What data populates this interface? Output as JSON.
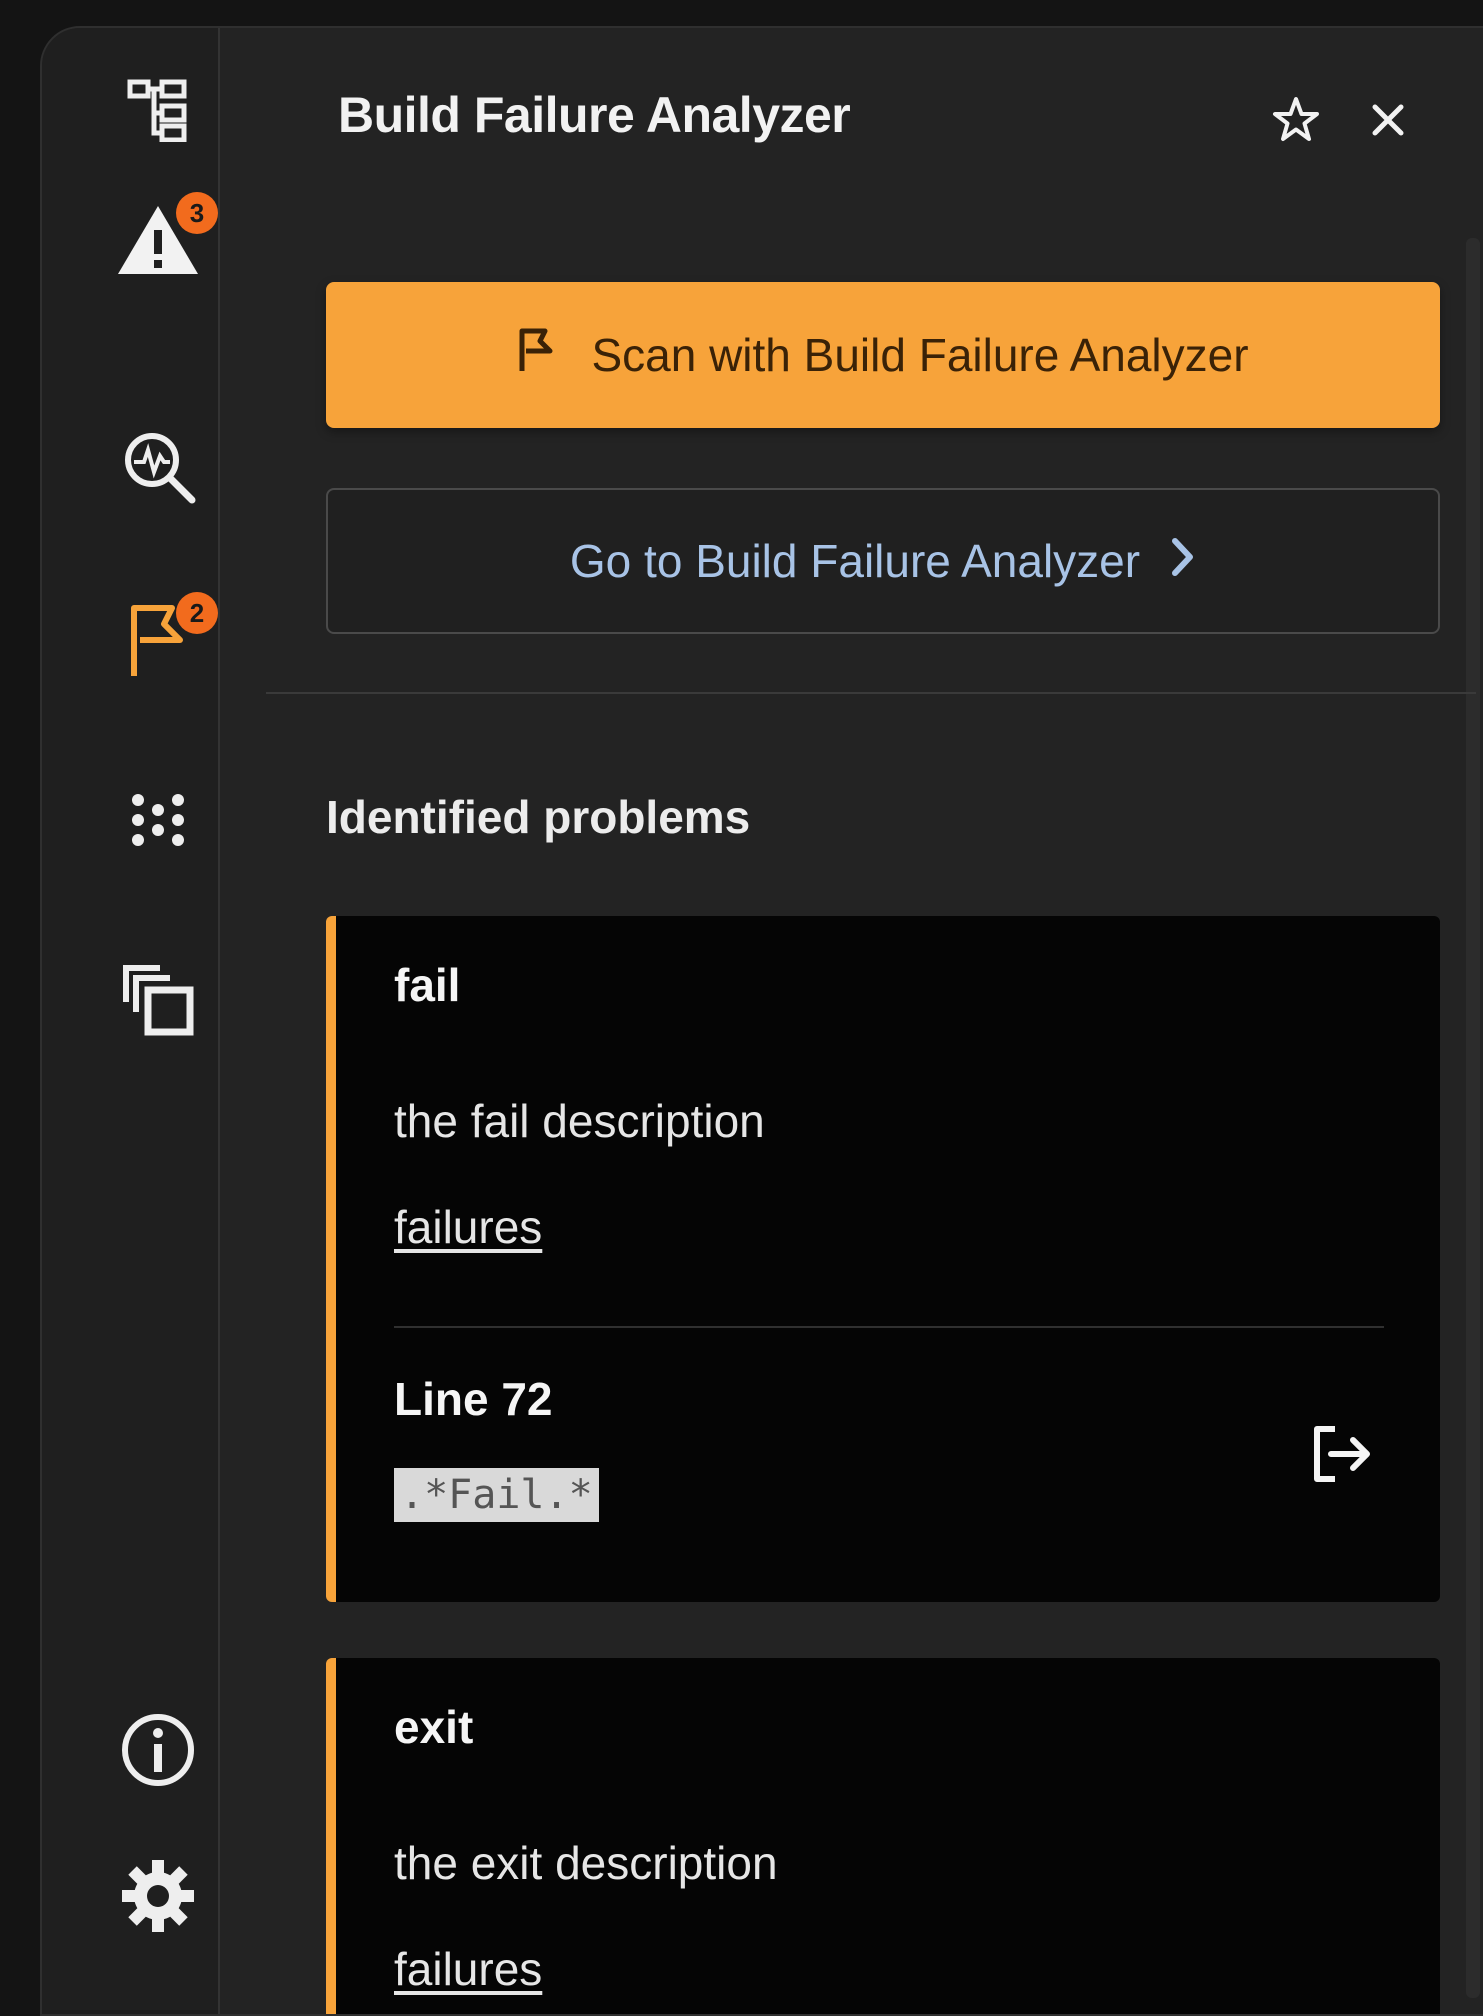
{
  "panel": {
    "title": "Build Failure Analyzer",
    "star_icon": "star-outline-icon",
    "close_icon": "close-icon"
  },
  "rail": {
    "items": [
      {
        "icon": "pipeline-tree-icon",
        "badge": ""
      },
      {
        "icon": "warning-icon",
        "badge": "3"
      },
      {
        "icon": "search-analysis-icon",
        "badge": ""
      },
      {
        "icon": "flag-icon",
        "badge": "2",
        "active": true
      },
      {
        "icon": "cluster-dots-icon",
        "badge": ""
      },
      {
        "icon": "copy-windows-icon",
        "badge": ""
      }
    ],
    "bottom": [
      {
        "icon": "info-icon"
      },
      {
        "icon": "gear-icon"
      }
    ]
  },
  "actions": {
    "scan_label": "Scan with Build Failure Analyzer",
    "goto_label": "Go to Build Failure Analyzer"
  },
  "problems": {
    "heading": "Identified problems",
    "items": [
      {
        "name": "fail",
        "description": "the fail description",
        "category": "failures",
        "line": "Line 72",
        "pattern": ".*Fail.*"
      },
      {
        "name": "exit",
        "description": "the exit description",
        "category": "failures"
      }
    ]
  },
  "colors": {
    "accent": "#f7a33a",
    "badge": "#f26b1d",
    "link": "#a8c3e6",
    "background": "#232323"
  }
}
